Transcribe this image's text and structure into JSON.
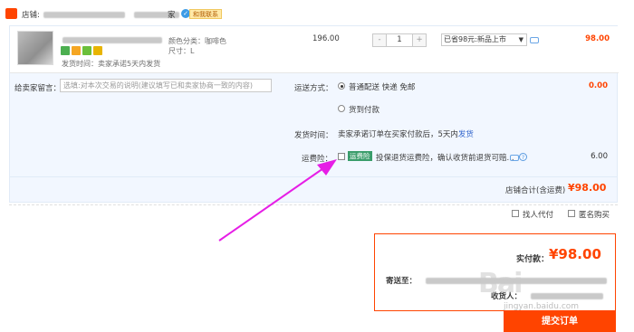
{
  "shop": {
    "label": "店铺:",
    "seller_suffix": "家",
    "chat_label": "和我联系"
  },
  "item": {
    "color_label": "颜色分类：咖啡色",
    "size_label": "尺寸：L",
    "ship_time": "发货时间：卖家承诺5天内发货",
    "price": "196.00",
    "quantity": "1",
    "qty_minus": "-",
    "qty_plus": "+",
    "promo_selected": "已省98元:新品上市",
    "subtotal": "98.00"
  },
  "message": {
    "label": "给卖家留言：",
    "placeholder": "选填:对本次交易的说明(建议填写已和卖家协商一致的内容)"
  },
  "shipping": {
    "method_label": "运送方式：",
    "option_standard": "普通配送 快递 免邮",
    "option_cod": "货到付款",
    "fee": "0.00",
    "time_label": "发货时间：",
    "time_value_prefix": "卖家承诺订单在买家付款后，5天内",
    "time_value_link": "发货"
  },
  "insurance": {
    "label": "运费险：",
    "badge": "运费险",
    "desc": "投保退货运费险，确认收货前退货可赔...",
    "price": "6.00"
  },
  "total": {
    "label": "店铺合计(含运费)",
    "amount": "¥98.00"
  },
  "options": {
    "proxy_pay": "找人代付",
    "anonymous": "匿名购买"
  },
  "payment": {
    "label": "实付款：",
    "amount": "¥98.00",
    "address_label": "寄送至：",
    "receiver_label": "收货人："
  },
  "submit_label": "提交订单",
  "watermark": {
    "url": "jingyan.baidu.com"
  },
  "colors": {
    "accent": "#ff4400",
    "highlight_bg": "#f2f7ff",
    "arrow": "#e61ee6"
  }
}
